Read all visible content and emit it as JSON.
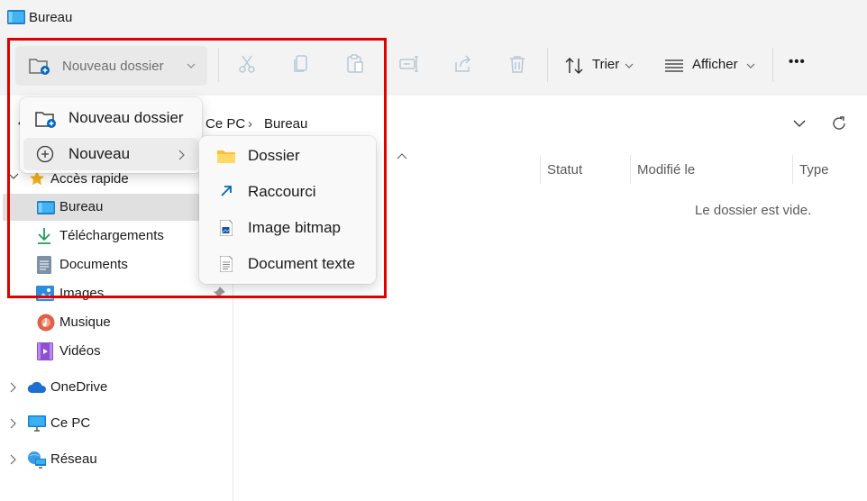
{
  "window": {
    "title": "Bureau",
    "icon": "desktop-folder-icon"
  },
  "toolbar": {
    "new_button_label": "Nouveau dossier",
    "sort_label": "Trier",
    "view_label": "Afficher",
    "more_label": "•••"
  },
  "address": {
    "crumbs": [
      "Ce PC",
      "Bureau"
    ],
    "separator": "›"
  },
  "columns": {
    "status": "Statut",
    "modified": "Modifié le",
    "type": "Type"
  },
  "content": {
    "empty_message": "Le dossier est vide."
  },
  "sidebar": {
    "quick_access": "Accès rapide",
    "items": [
      {
        "label": "Bureau",
        "icon": "desktop-icon",
        "selected": true
      },
      {
        "label": "Téléchargements",
        "icon": "download-icon"
      },
      {
        "label": "Documents",
        "icon": "documents-icon"
      },
      {
        "label": "Images",
        "icon": "images-icon"
      },
      {
        "label": "Musique",
        "icon": "music-icon"
      },
      {
        "label": "Vidéos",
        "icon": "videos-icon"
      }
    ],
    "roots": [
      {
        "label": "OneDrive",
        "icon": "cloud-icon"
      },
      {
        "label": "Ce PC",
        "icon": "monitor-icon"
      },
      {
        "label": "Réseau",
        "icon": "network-icon"
      }
    ]
  },
  "new_menu": {
    "items": [
      {
        "label": "Nouveau dossier",
        "icon": "new-folder-icon"
      },
      {
        "label": "Nouveau",
        "icon": "plus-circle-icon",
        "highlighted": true
      }
    ]
  },
  "submenu": {
    "items": [
      {
        "label": "Dossier",
        "icon": "folder-icon"
      },
      {
        "label": "Raccourci",
        "icon": "shortcut-arrow-icon"
      },
      {
        "label": "Image bitmap",
        "icon": "bitmap-icon"
      },
      {
        "label": "Document texte",
        "icon": "text-document-icon"
      }
    ]
  },
  "colors": {
    "highlight_border": "#e00000",
    "accent": "#0067c0",
    "folder": "#f8c13a"
  }
}
